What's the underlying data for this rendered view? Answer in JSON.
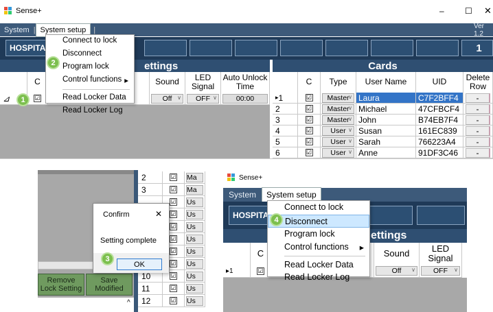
{
  "app": {
    "title": "Sense+",
    "version": "Ver 1.2"
  },
  "window_controls": {
    "minimize": "–",
    "maximize": "☐",
    "close": "✕"
  },
  "menubar": {
    "system": "System",
    "system_setup": "System setup"
  },
  "nav": {
    "hospital": "HOSPITA",
    "page_number": "1"
  },
  "settings": {
    "title": "ettings",
    "title_bottom": "ettings",
    "col_c": "C",
    "col_sound": "Sound",
    "col_led": "LED Signal",
    "col_auto_unlock": "Auto Unlock Time",
    "row1": {
      "marker": "1",
      "sound": "Off",
      "led": "OFF",
      "auto_unlock": "00:00"
    }
  },
  "menu": {
    "connect": "Connect to lock",
    "disconnect": "Disconnect",
    "program": "Program lock",
    "control": "Control functions",
    "read_data": "Read Locker Data",
    "read_log": "Read Locker Log",
    "submenu_arrow": "▸"
  },
  "cards": {
    "title": "Cards",
    "headers": {
      "c": "C",
      "type": "Type",
      "user_name": "User Name",
      "uid": "UID",
      "delete_row": "Delete Row"
    },
    "rows": [
      {
        "num": "1",
        "type": "Master",
        "name": "Laura",
        "uid": "C7F2BFF4",
        "del": "-"
      },
      {
        "num": "2",
        "type": "Master",
        "name": "Michael",
        "uid": "47CFBCF4",
        "del": "-"
      },
      {
        "num": "3",
        "type": "Master",
        "name": "John",
        "uid": "B74EB7F4",
        "del": "-"
      },
      {
        "num": "4",
        "type": "User",
        "name": "Susan",
        "uid": "161EC839",
        "del": "-"
      },
      {
        "num": "5",
        "type": "User",
        "name": "Sarah",
        "uid": "766223A4",
        "del": "-"
      },
      {
        "num": "6",
        "type": "User",
        "name": "Anne",
        "uid": "91DF3C46",
        "del": "-"
      }
    ]
  },
  "steps": {
    "s1": "1",
    "s2": "2",
    "s3": "3",
    "s4": "4"
  },
  "confirm": {
    "title": "Confirm",
    "message": "Setting complete",
    "ok": "OK",
    "close": "✕"
  },
  "bottom_left": {
    "remove_button": "Remove Lock Setting",
    "save_button": "Save Modified",
    "rows": [
      {
        "num": "2",
        "type": "Ma"
      },
      {
        "num": "3",
        "type": "Ma"
      },
      {
        "num": "",
        "type": "Us"
      },
      {
        "num": "",
        "type": "Us"
      },
      {
        "num": "",
        "type": "Us"
      },
      {
        "num": "",
        "type": "Us"
      },
      {
        "num": "",
        "type": "Us"
      },
      {
        "num": "",
        "type": "Us"
      },
      {
        "num": "10",
        "type": "Us"
      },
      {
        "num": "11",
        "type": "Us"
      },
      {
        "num": "12",
        "type": "Us"
      }
    ],
    "scroll_up": "^"
  },
  "colors": {
    "menubar": "#3d5a7a",
    "nav": "#1f3a58",
    "header": "#2f4f72",
    "badge": "#7cbf4e",
    "highlight": "#cde8ff"
  }
}
